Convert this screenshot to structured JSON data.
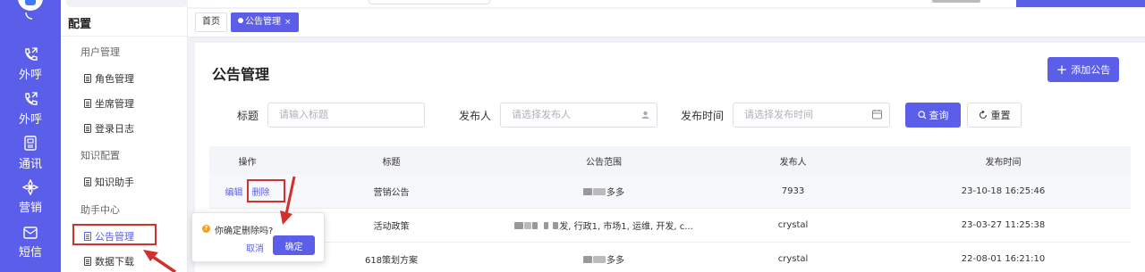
{
  "rail": {
    "items": [
      {
        "label": "外呼",
        "icon": "phone-out-icon"
      },
      {
        "label": "外呼",
        "icon": "phone-out-icon"
      },
      {
        "label": "通讯",
        "icon": "contacts-icon"
      },
      {
        "label": "营销",
        "icon": "marketing-icon"
      },
      {
        "label": "短信",
        "icon": "sms-icon"
      }
    ]
  },
  "menu": {
    "title": "配置",
    "groups": [
      {
        "label": "用户管理",
        "items": [
          "角色管理",
          "坐席管理",
          "登录日志"
        ]
      },
      {
        "label": "知识配置",
        "items": [
          "知识助手"
        ]
      },
      {
        "label": "助手中心",
        "items": [
          "公告管理",
          "数据下载"
        ]
      }
    ]
  },
  "tabs": [
    {
      "label": "首页"
    },
    {
      "label": "公告管理",
      "close": "×"
    }
  ],
  "page": {
    "title": "公告管理",
    "add_button": "添加公告"
  },
  "filters": {
    "title_label": "标题",
    "title_placeholder": "请输入标题",
    "publisher_label": "发布人",
    "publisher_placeholder": "请选择发布人",
    "time_label": "发布时间",
    "time_placeholder": "请选择发布时间",
    "query_button": "查询",
    "reset_button": "重置"
  },
  "table": {
    "columns": [
      "操作",
      "标题",
      "公告范围",
      "发布人",
      "发布时间"
    ],
    "actions": {
      "edit": "编辑",
      "delete": "删除"
    },
    "rows": [
      {
        "title": "营销公告",
        "scope": "多多",
        "publisher": "7933",
        "time": "23-10-18 16:25:46"
      },
      {
        "title": "活动政策",
        "scope": "发, 行政1, 市场1, 运维, 开发, c...",
        "publisher": "crystal",
        "time": "23-03-27 11:25:38"
      },
      {
        "title": "618策划方案",
        "scope": "多多",
        "publisher": "crystal",
        "time": "22-08-01 16:21:10"
      }
    ]
  },
  "popconfirm": {
    "question": "你确定删除吗?",
    "cancel": "取消",
    "confirm": "确定"
  },
  "colors": {
    "accent": "#5b5ee8",
    "highlight": "#d0312d",
    "warning": "#f0a020"
  }
}
